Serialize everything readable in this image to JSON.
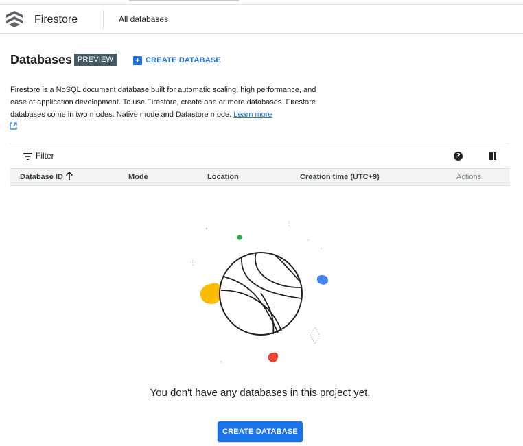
{
  "header": {
    "product_name": "Firestore",
    "breadcrumb": "All databases"
  },
  "page": {
    "title": "Databases",
    "badge": "PREVIEW",
    "create_top_label": "CREATE DATABASE",
    "description": "Firestore is a NoSQL document database built for automatic scaling, high performance, and ease of application development. To use Firestore, create one or more databases. Firestore databases come in two modes: Native mode and Datastore mode.",
    "learn_more": "Learn more"
  },
  "toolbar": {
    "filter_label": "Filter",
    "help_icon": "help-icon",
    "columns_icon": "column-display-icon"
  },
  "table": {
    "columns": [
      "Database ID",
      "Mode",
      "Location",
      "Creation time (UTC+9)",
      "Actions"
    ],
    "sort_icon": "arrow-up-icon"
  },
  "empty_state": {
    "message": "You don't have any databases in this project yet.",
    "button_label": "CREATE DATABASE"
  },
  "colors": {
    "accent": "#1a73e8",
    "badge_bg": "#455a64",
    "yellow": "#fbbc04",
    "green": "#34a853",
    "blue": "#4285f4",
    "red": "#ea4335"
  }
}
